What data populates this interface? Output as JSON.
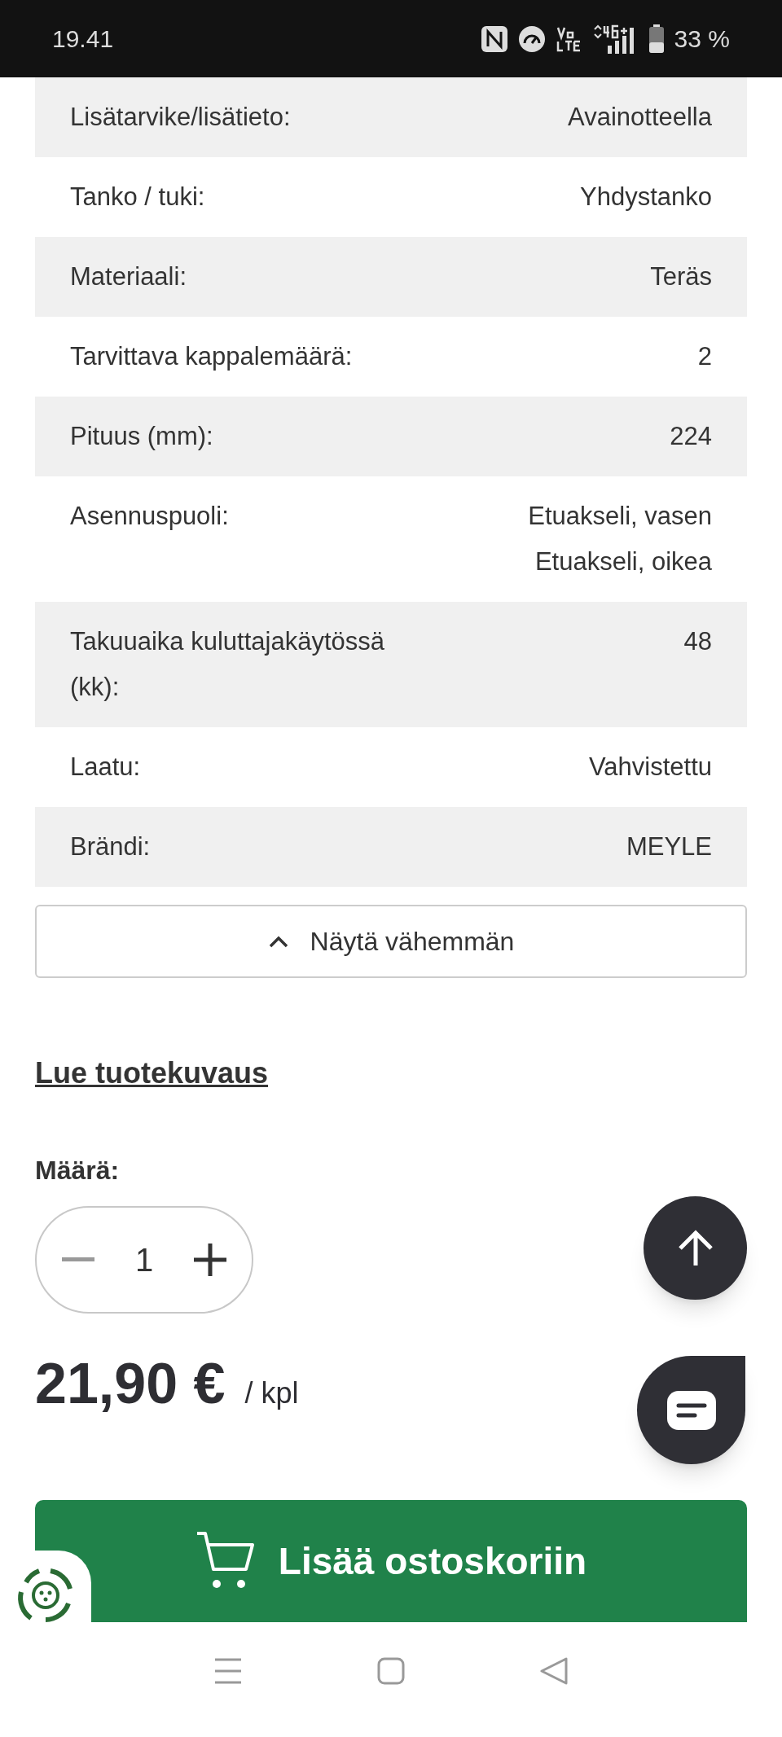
{
  "status_bar": {
    "time": "19.41",
    "battery": "33 %"
  },
  "specs": [
    {
      "label": "Lisätarvike/lisätieto:",
      "values": [
        "Avainotteella"
      ]
    },
    {
      "label": "Tanko / tuki:",
      "values": [
        "Yhdystanko"
      ]
    },
    {
      "label": "Materiaali:",
      "values": [
        "Teräs"
      ]
    },
    {
      "label": "Tarvittava kappalemäärä:",
      "values": [
        "2"
      ]
    },
    {
      "label": "Pituus (mm):",
      "values": [
        "224"
      ]
    },
    {
      "label": "Asennuspuoli:",
      "values": [
        "Etuakseli, vasen",
        "Etuakseli, oikea"
      ]
    },
    {
      "label": "Takuuaika kuluttajakäytössä (kk):",
      "values": [
        "48"
      ]
    },
    {
      "label": "Laatu:",
      "values": [
        "Vahvistettu"
      ]
    },
    {
      "label": "Brändi:",
      "values": [
        "MEYLE"
      ]
    }
  ],
  "show_less_button": "Näytä vähemmän",
  "description_link": "Lue tuotekuvaus",
  "quantity": {
    "label": "Määrä:",
    "value": "1",
    "decrease_disabled": true
  },
  "price": {
    "amount": "21,90 €",
    "unit": "/ kpl"
  },
  "add_to_cart_button": "Lisää ostoskoriin"
}
